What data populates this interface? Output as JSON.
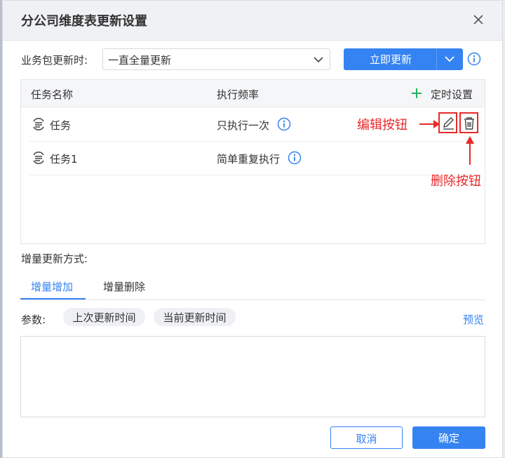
{
  "dialog": {
    "title": "分公司维度表更新设置"
  },
  "update_row": {
    "label": "业务包更新时:",
    "select_value": "一直全量更新",
    "update_now_label": "立即更新"
  },
  "task_table": {
    "col_name": "任务名称",
    "col_freq": "执行频率",
    "timer_label": "定时设置",
    "rows": [
      {
        "name": "任务",
        "frequency": "只执行一次"
      },
      {
        "name": "任务1",
        "frequency": "简单重复执行"
      }
    ]
  },
  "annotations": {
    "edit_label": "编辑按钮",
    "delete_label": "删除按钮",
    "color": "#e82a2a"
  },
  "incremental": {
    "label": "增量更新方式:",
    "tabs": [
      "增量增加",
      "增量删除"
    ],
    "active_tab": 0,
    "params_label": "参数:",
    "chips": [
      "上次更新时间",
      "当前更新时间"
    ],
    "preview_label": "预览"
  },
  "footer": {
    "cancel_label": "取消",
    "ok_label": "确定"
  },
  "colors": {
    "primary": "#3583f2",
    "add_icon": "#21b35d"
  }
}
